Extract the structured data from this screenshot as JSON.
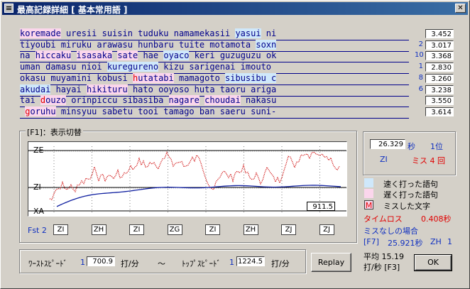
{
  "window": {
    "title": "最高記録詳細 [ 基本常用語 ]"
  },
  "text_lines": [
    {
      "segments": [
        {
          "t": "koremade",
          "k": "slow"
        },
        {
          "t": " uresii suisin tuduku namamekasii ",
          "k": ""
        },
        {
          "t": "yasui",
          "k": "fast"
        },
        {
          "t": " ni",
          "k": ""
        }
      ],
      "mark": "",
      "time": "3.452"
    },
    {
      "segments": [
        {
          "t": "tiyoubi miruku arawasu hunbaru tuite motamota ",
          "k": ""
        },
        {
          "t": "soxn",
          "k": "fast"
        }
      ],
      "mark": "2",
      "time": "3.017"
    },
    {
      "segments": [
        {
          "t": "na ",
          "k": ""
        },
        {
          "t": "hiccaku",
          "k": "slow"
        },
        {
          "t": " ",
          "k": ""
        },
        {
          "t": "isasaka",
          "k": "slow"
        },
        {
          "t": " ",
          "k": ""
        },
        {
          "t": "sate",
          "k": "slow"
        },
        {
          "t": " hae ",
          "k": ""
        },
        {
          "t": "oyaco",
          "k": "fast"
        },
        {
          "t": " keri guzuguzu ok",
          "k": ""
        }
      ],
      "mark": "10",
      "time": "3.368"
    },
    {
      "segments": [
        {
          "t": "uman damasu nioi ",
          "k": ""
        },
        {
          "t": "kuregureno",
          "k": "fast"
        },
        {
          "t": " kizu sarigenai imouto",
          "k": ""
        }
      ],
      "mark": "1",
      "time": "2.830"
    },
    {
      "segments": [
        {
          "t": "okasu muyamini kobusi ",
          "k": ""
        },
        {
          "t": "hutatabi",
          "k": "slow",
          "miss": true
        },
        {
          "t": " mamagoto ",
          "k": ""
        },
        {
          "t": "sibusibu c",
          "k": "fast"
        }
      ],
      "mark": "8",
      "time": "3.260"
    },
    {
      "segments": [
        {
          "t": "akudai",
          "k": "fast"
        },
        {
          "t": " hayai ",
          "k": ""
        },
        {
          "t": "hikituru",
          "k": "slow"
        },
        {
          "t": " hato ooyoso huta taoru ariga",
          "k": ""
        }
      ],
      "mark": "6",
      "time": "3.238"
    },
    {
      "segments": [
        {
          "t": "tai ",
          "k": ""
        },
        {
          "t": "douzo",
          "k": "slow",
          "miss": true
        },
        {
          "t": " orinpiccu sibasiba ",
          "k": ""
        },
        {
          "t": "nagare",
          "k": "slow"
        },
        {
          "t": " ",
          "k": ""
        },
        {
          "t": "choudai",
          "k": "slow"
        },
        {
          "t": " nakasu",
          "k": ""
        }
      ],
      "mark": "",
      "time": "3.550"
    },
    {
      "segments": [
        {
          "t": " ",
          "k": ""
        },
        {
          "t": "goruhu",
          "k": "slow",
          "miss": true
        },
        {
          "t": " minsyuu sabetu tooi tamago ban saeru suni-",
          "k": ""
        }
      ],
      "mark": "",
      "time": "3.614"
    }
  ],
  "graph": {
    "legend": "[F1]：表示切替",
    "y_labels": [
      "ZE",
      "ZI",
      "XA"
    ],
    "readout": "911.5",
    "fst_label": "Fst 2",
    "ranks": [
      "ZI",
      "ZH",
      "ZI",
      "ZG",
      "ZI",
      "ZH",
      "ZJ",
      "ZJ"
    ]
  },
  "result": {
    "time": "26.329",
    "time_unit": "秒",
    "place": "1位",
    "rank": "ZI",
    "miss": "ミス 4 回"
  },
  "legend": {
    "fast": "速く打った語句",
    "slow": "遅く打った語句",
    "miss_glyph": "M",
    "miss": "ミスした文字"
  },
  "timeloss": {
    "label": "タイムロス",
    "value": "0.408秒"
  },
  "nomiss": {
    "label": "ミスなしの場合",
    "key": "[F7]",
    "time": "25.921秒",
    "rank": "ZH",
    "place": "1"
  },
  "average": {
    "line1": "平均 15.19",
    "line2": "打/秒 [F3]"
  },
  "speed": {
    "worst_label": "ﾜｰｽﾄｽﾋﾟｰﾄﾞ",
    "worst_rank": "1",
    "worst_value": "700.9",
    "unit": "打/分",
    "tilde": "～",
    "top_label": "ﾄｯﾌﾟｽﾋﾟｰﾄﾞ",
    "top_rank": "1",
    "top_value": "1224.5"
  },
  "buttons": {
    "replay": "Replay",
    "ok": "OK"
  },
  "colors": {
    "fast": "#cfe8fb",
    "slow": "#fbd6ec",
    "miss": "#e00000",
    "text": "#00008b"
  }
}
